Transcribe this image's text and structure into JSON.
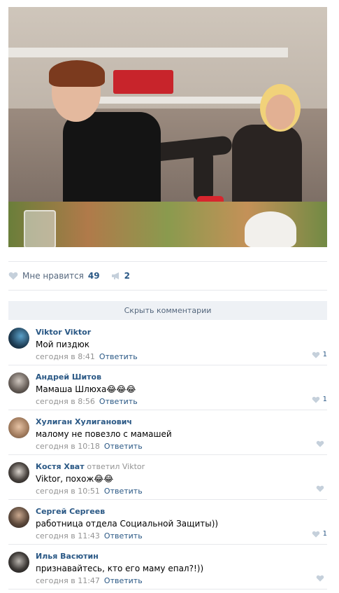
{
  "post": {
    "photo_alt": "",
    "likes": {
      "label": "Мне нравится",
      "count": "49"
    },
    "shares": {
      "count": "2"
    }
  },
  "comments_bar": {
    "label": "Скрыть комментарии"
  },
  "colors": {
    "link": "#2a5885",
    "muted": "#939393",
    "bar_bg": "#eef1f5",
    "divider": "#e7e8ec",
    "heart": "#c5d0db"
  },
  "comments": [
    {
      "author": "Viktor Viktor",
      "replied_to": "",
      "text": "Мой пиздюк",
      "time": "сегодня в 8:41",
      "reply_label": "Ответить",
      "likes": "1"
    },
    {
      "author": "Андрей Шитов",
      "replied_to": "",
      "text": "Мамаша Шлюха😂😂😂",
      "time": "сегодня в 8:56",
      "reply_label": "Ответить",
      "likes": "1"
    },
    {
      "author": "Хулиган Хулиганович",
      "replied_to": "",
      "text": "малому не повезло с мамашей",
      "time": "сегодня в 10:18",
      "reply_label": "Ответить",
      "likes": ""
    },
    {
      "author": "Костя Хват",
      "replied_to": "ответил Viktor",
      "text": "Viktor, похож😂😂",
      "time": "сегодня в 10:51",
      "reply_label": "Ответить",
      "likes": ""
    },
    {
      "author": "Сергей Сергеев",
      "replied_to": "",
      "text": "работница отдела Социальной Защиты))",
      "time": "сегодня в 11:43",
      "reply_label": "Ответить",
      "likes": "1"
    },
    {
      "author": "Илья Васютин",
      "replied_to": "",
      "text": "признавайтесь, кто его маму епал?!))",
      "time": "сегодня в 11:47",
      "reply_label": "Ответить",
      "likes": ""
    }
  ]
}
